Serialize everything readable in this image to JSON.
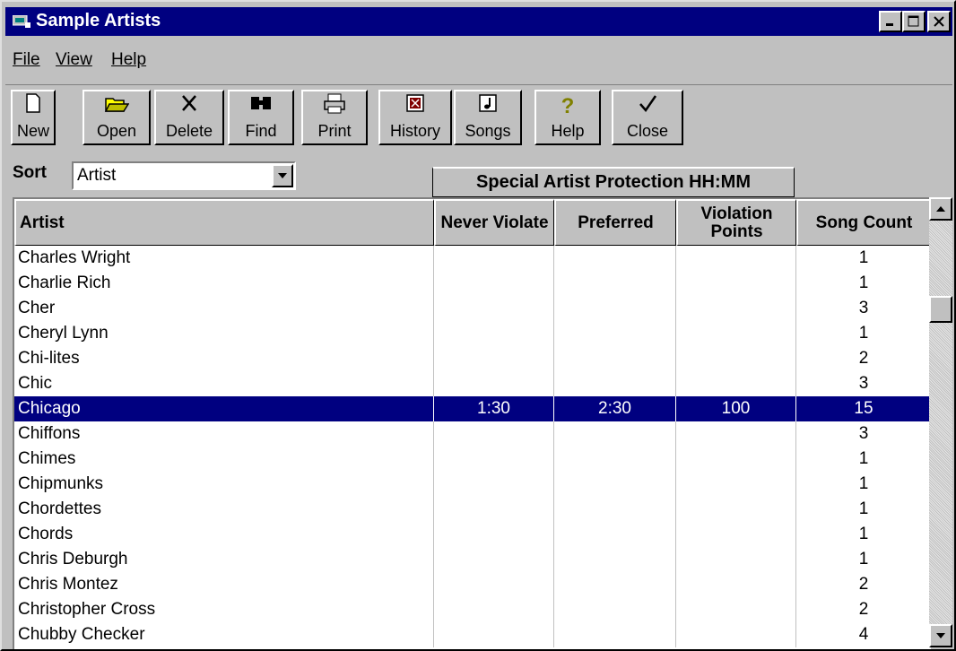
{
  "window": {
    "title": "Sample Artists"
  },
  "menu": [
    {
      "label": "File"
    },
    {
      "label": "View"
    },
    {
      "label": "Help"
    }
  ],
  "toolbar": [
    {
      "label": "New",
      "icon": "new-document-icon"
    },
    {
      "label": "Open",
      "icon": "open-folder-icon"
    },
    {
      "label": "Delete",
      "icon": "delete-x-icon"
    },
    {
      "label": "Find",
      "icon": "binoculars-icon"
    },
    {
      "label": "Print",
      "icon": "printer-icon"
    },
    {
      "label": "History",
      "icon": "history-icon"
    },
    {
      "label": "Songs",
      "icon": "music-note-icon"
    },
    {
      "label": "Help",
      "icon": "help-question-icon"
    },
    {
      "label": "Close",
      "icon": "checkmark-icon"
    }
  ],
  "sort": {
    "label": "Sort",
    "value": "Artist"
  },
  "grid": {
    "group_header": "Special Artist Protection HH:MM",
    "columns": [
      "Artist",
      "Never Violate",
      "Preferred",
      "Violation Points",
      "Song Count"
    ],
    "rows": [
      {
        "artist": "Charles Wright",
        "never": "",
        "preferred": "",
        "points": "",
        "count": "1"
      },
      {
        "artist": "Charlie Rich",
        "never": "",
        "preferred": "",
        "points": "",
        "count": "1"
      },
      {
        "artist": "Cher",
        "never": "",
        "preferred": "",
        "points": "",
        "count": "3"
      },
      {
        "artist": "Cheryl Lynn",
        "never": "",
        "preferred": "",
        "points": "",
        "count": "1"
      },
      {
        "artist": "Chi-lites",
        "never": "",
        "preferred": "",
        "points": "",
        "count": "2"
      },
      {
        "artist": "Chic",
        "never": "",
        "preferred": "",
        "points": "",
        "count": "3"
      },
      {
        "artist": "Chicago",
        "never": "1:30",
        "preferred": "2:30",
        "points": "100",
        "count": "15",
        "selected": true
      },
      {
        "artist": "Chiffons",
        "never": "",
        "preferred": "",
        "points": "",
        "count": "3"
      },
      {
        "artist": "Chimes",
        "never": "",
        "preferred": "",
        "points": "",
        "count": "1"
      },
      {
        "artist": "Chipmunks",
        "never": "",
        "preferred": "",
        "points": "",
        "count": "1"
      },
      {
        "artist": "Chordettes",
        "never": "",
        "preferred": "",
        "points": "",
        "count": "1"
      },
      {
        "artist": "Chords",
        "never": "",
        "preferred": "",
        "points": "",
        "count": "1"
      },
      {
        "artist": "Chris Deburgh",
        "never": "",
        "preferred": "",
        "points": "",
        "count": "1"
      },
      {
        "artist": "Chris Montez",
        "never": "",
        "preferred": "",
        "points": "",
        "count": "2"
      },
      {
        "artist": "Christopher Cross",
        "never": "",
        "preferred": "",
        "points": "",
        "count": "2"
      },
      {
        "artist": "Chubby Checker",
        "never": "",
        "preferred": "",
        "points": "",
        "count": "4"
      }
    ]
  },
  "colors": {
    "titlebar": "#000080",
    "face": "#c0c0c0",
    "selection": "#000080"
  }
}
